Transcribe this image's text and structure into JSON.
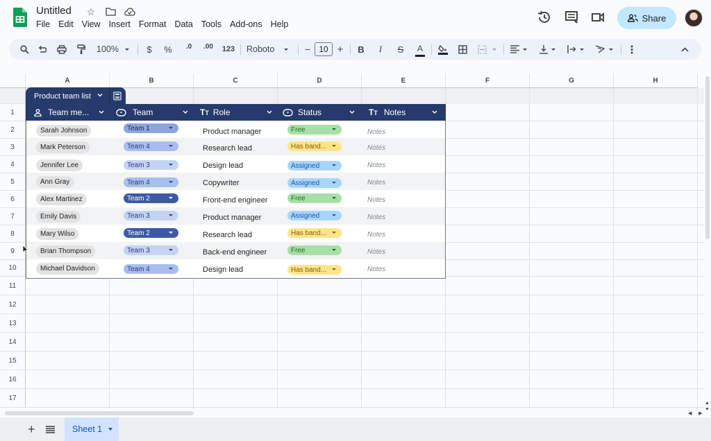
{
  "app": {
    "title": "Untitled",
    "title_icons": [
      "star-icon",
      "folder-icon",
      "cloud-saved-icon"
    ],
    "menu": [
      "File",
      "Edit",
      "View",
      "Insert",
      "Format",
      "Data",
      "Tools",
      "Add-ons",
      "Help"
    ],
    "share_label": "Share",
    "header_icons": [
      "history-icon",
      "comment-icon",
      "meet-icon"
    ],
    "brand_color": "#0f9d58"
  },
  "toolbar": {
    "zoom": "100%",
    "currency": "$",
    "percent": "%",
    "dec_decrease": ".0",
    "dec_increase": ".00",
    "number_format": "123",
    "font": "Roboto",
    "font_size": "10",
    "minus": "−",
    "plus": "+",
    "bold": "B",
    "italic": "I",
    "strike": "S",
    "text_color": "A"
  },
  "grid": {
    "columns": [
      "A",
      "B",
      "C",
      "D",
      "E",
      "F",
      "G",
      "H"
    ],
    "rows": [
      "1",
      "2",
      "3",
      "4",
      "5",
      "6",
      "7",
      "8",
      "9",
      "10",
      "11",
      "12",
      "13",
      "14",
      "15",
      "16",
      "17"
    ]
  },
  "table": {
    "name": "Product team list",
    "header_color": "#263a6b",
    "columns": [
      {
        "label": "Team me...",
        "icon": "person-icon"
      },
      {
        "label": "Team",
        "icon": "dropdown-chip-icon"
      },
      {
        "label": "Role",
        "icon": "text-type-icon"
      },
      {
        "label": "Status",
        "icon": "dropdown-chip-icon"
      },
      {
        "label": "Notes",
        "icon": "text-type-icon"
      }
    ],
    "rows": [
      {
        "member": "Sarah Johnson",
        "team": "Team 1",
        "role": "Product manager",
        "status": "Free",
        "notes": "Notes"
      },
      {
        "member": "Mark Peterson",
        "team": "Team 4",
        "role": "Research lead",
        "status": "Has band...",
        "notes": "Notes"
      },
      {
        "member": "Jennifer Lee",
        "team": "Team 3",
        "role": "Design lead",
        "status": "Assigned",
        "notes": "Notes"
      },
      {
        "member": "Ann Gray",
        "team": "Team 4",
        "role": "Copywriter",
        "status": "Assigned",
        "notes": "Notes"
      },
      {
        "member": "Alex Martinez",
        "team": "Team 2",
        "role": "Front-end engineer",
        "status": "Free",
        "notes": "Notes"
      },
      {
        "member": "Emily Davis",
        "team": "Team 3",
        "role": "Product manager",
        "status": "Assigned",
        "notes": "Notes"
      },
      {
        "member": "Mary Wilso",
        "team": "Team 2",
        "role": "Research lead",
        "status": "Has band...",
        "notes": "Notes"
      },
      {
        "member": "Brian Thompson",
        "team": "Team 3",
        "role": "Back-end engineer",
        "status": "Free",
        "notes": "Notes"
      },
      {
        "member": "Michael Davidson",
        "team": "Team 4",
        "role": "Design lead",
        "status": "Has band...",
        "notes": "Notes"
      }
    ],
    "team_colors": {
      "Team 1": {
        "bg": "#8fa4dd",
        "fg": "#1f2d5c"
      },
      "Team 2": {
        "bg": "#3d5aa8",
        "fg": "#ffffff"
      },
      "Team 3": {
        "bg": "#c5d3f2",
        "fg": "#2a3f7a"
      },
      "Team 4": {
        "bg": "#a9bdee",
        "fg": "#2a3f7a"
      }
    },
    "status_colors": {
      "Free": {
        "bg": "#a8dfa6",
        "fg": "#1e6b2a"
      },
      "Has band...": {
        "bg": "#fde68a",
        "fg": "#8a5a00"
      },
      "Assigned": {
        "bg": "#a8d6fb",
        "fg": "#1a56a8"
      }
    }
  },
  "sheets": {
    "add_label": "+",
    "active_sheet": "Sheet 1"
  }
}
